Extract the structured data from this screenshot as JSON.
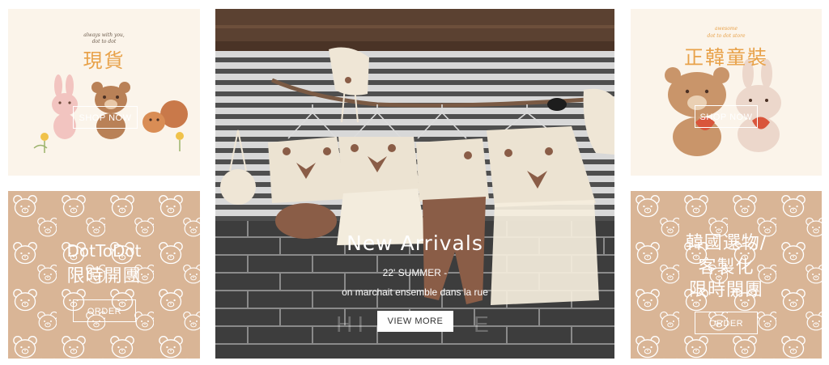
{
  "tiles": {
    "top_left": {
      "tagline_1": "always with you,",
      "tagline_2": "dot to dot",
      "title": "現貨",
      "button": "SHOP NOW"
    },
    "bottom_left": {
      "title_1": "DotToDot",
      "title_2": "限時開團",
      "button": "ORDER"
    },
    "top_right": {
      "tagline_1": "awesome",
      "tagline_2": "dot to dot store",
      "title": "正韓童裝",
      "button": "SHOP NOW"
    },
    "bottom_right": {
      "title_1": "韓國選物/",
      "title_2": "客製化",
      "title_3": "限時開團",
      "button": "ORDER"
    }
  },
  "hero": {
    "title": "New Arrivals",
    "subtitle": "22' SUMMER -",
    "caption": "on marchait ensemble dans la rue",
    "watermark": "HI",
    "watermark_right": "E",
    "button": "VIEW MORE"
  },
  "colors": {
    "cream": "#fbf4ea",
    "tan": "#d9b596",
    "orange": "#e8a24a",
    "brown": "#8a5d47"
  }
}
